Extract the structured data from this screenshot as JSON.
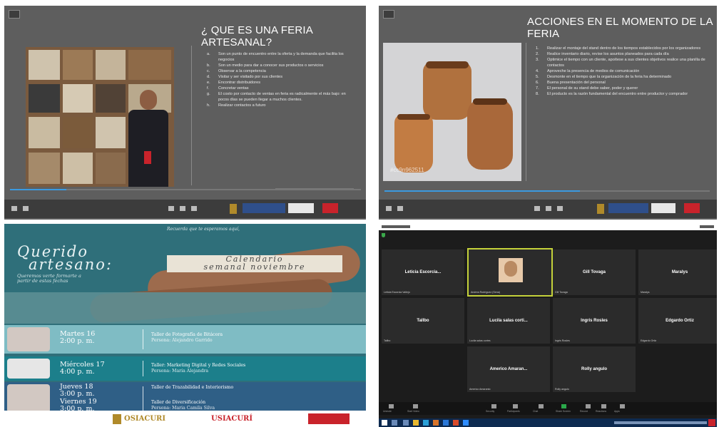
{
  "slide1": {
    "title": "¿ QUE ES UNA FERIA ARTESANAL?",
    "items": [
      {
        "n": "a.",
        "text": "Son un punto de encuentro entre la oferta y la demanda que facilita los negocios"
      },
      {
        "n": "b.",
        "text": "Son un medio para dar a conocer sus productos o servicios"
      },
      {
        "n": "c.",
        "text": "Observar a la competencia"
      },
      {
        "n": "d.",
        "text": "Visitar y ser visitado por sus clientes"
      },
      {
        "n": "e.",
        "text": "Encontrar distribuidores"
      },
      {
        "n": "f.",
        "text": "Concretar ventas"
      },
      {
        "n": "g.",
        "text": "El costo por contacto de ventas en feria es radicalmente el más bajo: en pocos días se pueden llegar a muchos clientes."
      },
      {
        "n": "h.",
        "text": "Realizar contactos a futuro"
      }
    ]
  },
  "slide2": {
    "title": "ACCIONES EN EL MOMENTO DE LA FERIA",
    "items": [
      {
        "n": "1.",
        "text": "Realizar el montaje del stand dentro de los tiempos establecidos por los organizadores"
      },
      {
        "n": "2.",
        "text": "Realice inventario diario, revise los asuntos planeados para cada día"
      },
      {
        "n": "3.",
        "text": "Optimice el tiempo con un cliente, apoítese a sus clientes objetivos realice una planilla de contactos"
      },
      {
        "n": "4.",
        "text": "Aproveche la presencia de medios de comunicación"
      },
      {
        "n": "5.",
        "text": "Desmonte en el tiempo que la organización de la feria ha determinado"
      },
      {
        "n": "6.",
        "text": "Buena presentación del personal"
      },
      {
        "n": "7.",
        "text": "El personal de su stand debe saber, poder y querer"
      },
      {
        "n": "8.",
        "text": "El producto es la razón fundamental del encuentro entre productor y comprador"
      }
    ],
    "watermark": "#cc9n962511"
  },
  "flyer": {
    "top_text": "Recuerda que te esperamos aquí,",
    "greeting_1": "Querido",
    "greeting_2": "artesano:",
    "subtext": "Queremos verte formarte a partir de estas fechas",
    "banner_1": "Calendario",
    "banner_2": "semanal noviembre",
    "schedule": [
      {
        "day": "Martes 16",
        "time": "2:00 p. m.",
        "event": "Taller de Fotografía de Bitácora",
        "host": "Persona: Alejandro Garrido"
      },
      {
        "day": "Miércoles 17",
        "time": "4:00 p. m.",
        "event": "Taller: Marketing Digital y Redes Sociales",
        "host": "Persona: María Alejandra"
      },
      {
        "day": "Jueves 18",
        "time": "3:00 p. m.",
        "event": "Taller de Trazabilidad e Interiorismo",
        "host": ""
      },
      {
        "day": "Viernes 19",
        "time": "3:00 p. m.",
        "event": "Taller de Diversificación",
        "host": "Persona: Maria Camila Silva"
      }
    ],
    "logos": [
      "OSIACURI",
      "USIACURÍ"
    ]
  },
  "zoom": {
    "participants": [
      {
        "name": "Leticia Escorcia...",
        "label": "Leticia Escorcia Vallejo"
      },
      {
        "name": "",
        "label": "Andrea Rodríguez (Sena)"
      },
      {
        "name": "Gill Tovaga",
        "label": "Gill Tovaga"
      },
      {
        "name": "Maralys",
        "label": "Maralys"
      },
      {
        "name": "Tallbo",
        "label": "Tallbo"
      },
      {
        "name": "Lucila salas corti...",
        "label": "Lucila salas cortes"
      },
      {
        "name": "Ingris Rosles",
        "label": "Ingris Rosles"
      },
      {
        "name": "Edgardo Ortiz",
        "label": "Edgardo Ortiz"
      },
      {
        "name": "Americo Amaran...",
        "label": "Americo Amaranto"
      },
      {
        "name": "Rolly angulo",
        "label": "Rolly angulo"
      }
    ],
    "controls": [
      "Unmute",
      "Start Video",
      "Security",
      "Participants",
      "Chat",
      "Share Screen",
      "Record",
      "Reactions",
      "Apps"
    ]
  },
  "colors": {
    "accent_blue": "#3b9ae0",
    "speaker_highlight": "#c5d23a",
    "logo_red": "#c9232b"
  }
}
